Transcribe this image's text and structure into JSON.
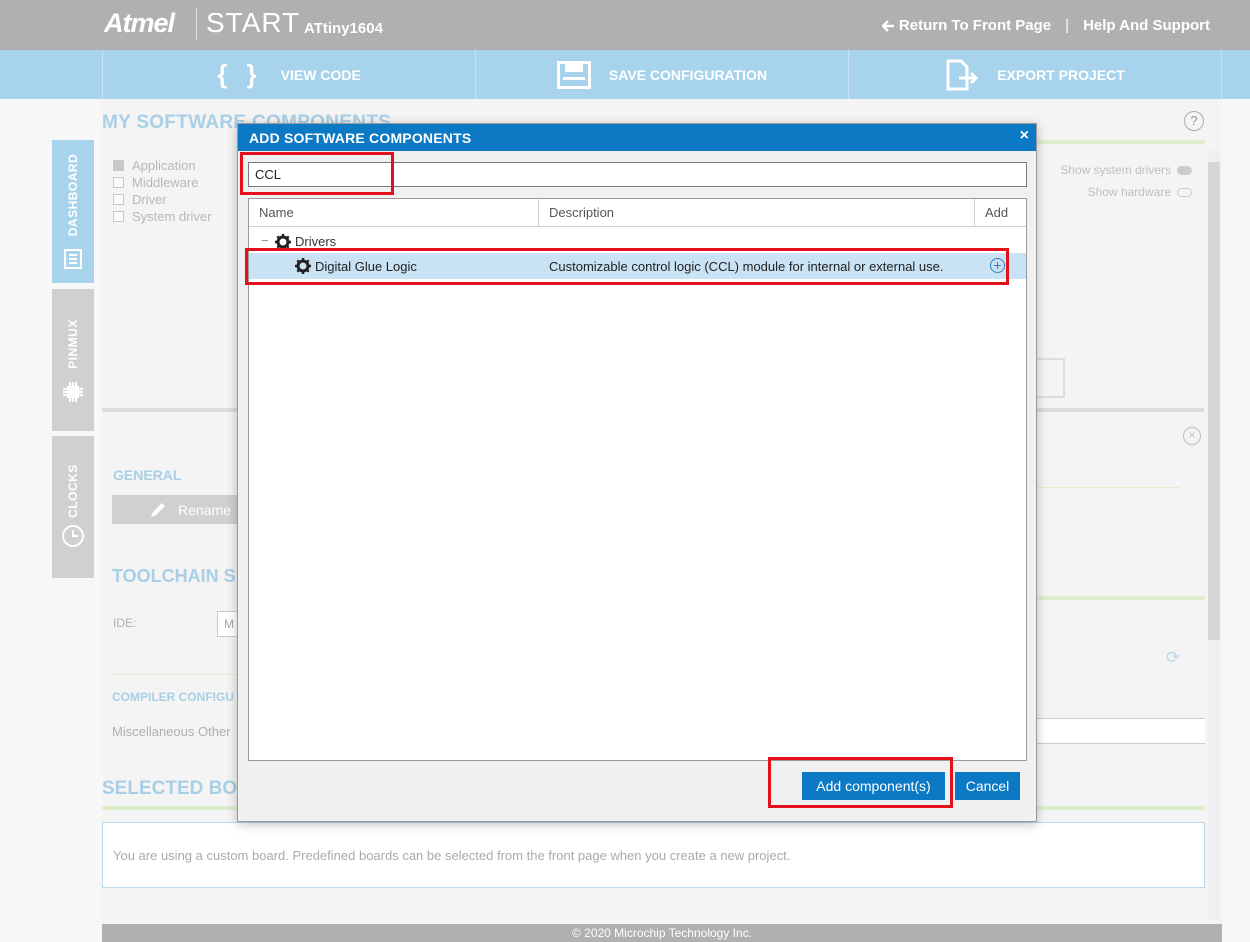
{
  "header": {
    "brand": "Atmel",
    "product": "START",
    "device": "ATtiny1604",
    "return_link": "Return To Front Page",
    "separator": "|",
    "help_link": "Help And Support"
  },
  "toolbar": {
    "view_code": "VIEW CODE",
    "save_configuration": "SAVE CONFIGURATION",
    "export_project": "EXPORT PROJECT",
    "view_code_icon": "{ }"
  },
  "sidebar": {
    "tabs": [
      {
        "label": "DASHBOARD",
        "icon": "dashboard-icon"
      },
      {
        "label": "PINMUX",
        "icon": "chip-icon"
      },
      {
        "label": "CLOCKS",
        "icon": "clock-icon"
      }
    ]
  },
  "background": {
    "section_title": "MY SOFTWARE COMPONENTS",
    "filters": [
      "Application",
      "Middleware",
      "Driver",
      "System driver"
    ],
    "show_system_drivers": "Show system drivers",
    "show_hardware": "Show hardware",
    "general_title": "GENERAL",
    "rename_label": "Rename",
    "toolchain_title": "TOOLCHAIN S",
    "ide_label": "IDE:",
    "ide_value": "M",
    "compiler_title": "COMPILER CONFIGU",
    "misc_label": "Miscellaneous Other",
    "board_title": "SELECTED BOA",
    "board_text": "You are using a custom board. Predefined boards can be selected from the front page when you create a new project.",
    "help_symbol": "?",
    "footer": "© 2020 Microchip Technology Inc."
  },
  "modal": {
    "title": "ADD SOFTWARE COMPONENTS",
    "close_symbol": "×",
    "search_value": "CCL",
    "columns": {
      "name": "Name",
      "description": "Description",
      "add": "Add"
    },
    "tree": {
      "expander": "−",
      "group": "Drivers",
      "item_name": "Digital Glue Logic",
      "item_description": "Customizable control logic (CCL) module for internal or external use.",
      "add_symbol": "+"
    },
    "add_button": "Add component(s)",
    "cancel_button": "Cancel"
  },
  "colors": {
    "accent": "#0b79c4",
    "header_gray": "#b0b0b0",
    "toolbar_blue": "#a7d3ec",
    "selected_row": "#c9e2f4",
    "annotation_red": "#e3101d"
  }
}
